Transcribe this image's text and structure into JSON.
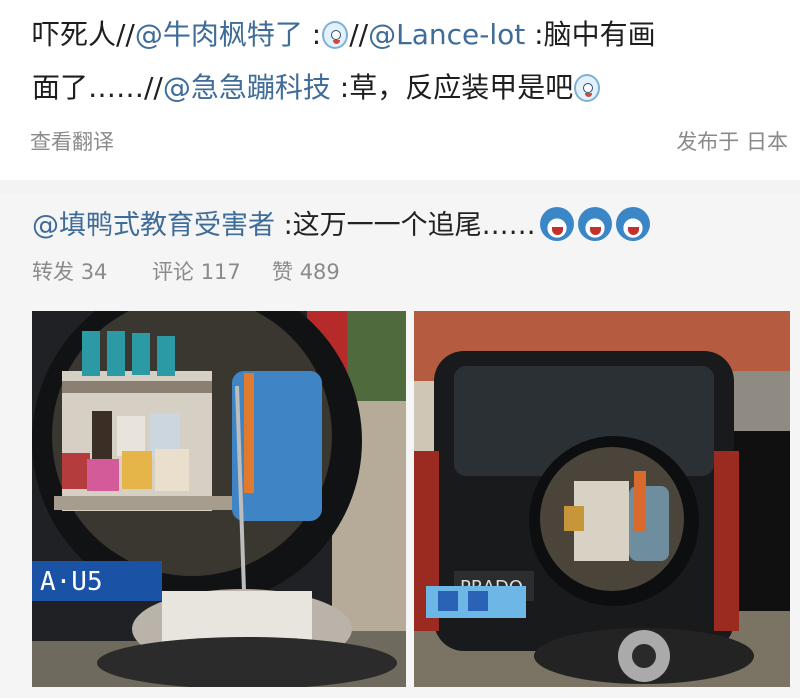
{
  "post": {
    "line1": {
      "prefix": "吓死人//",
      "mention1": "@牛肉枫特了",
      "after1": " :",
      "sep": "//",
      "mention2": "@Lance-lot",
      "after2": " :脑中有画"
    },
    "line2": {
      "prefix": "面了……//",
      "mention": "@急急蹦科技",
      "after": " :草，反应装甲是吧"
    },
    "translate_label": "查看翻译",
    "published": "发布于 日本"
  },
  "repost": {
    "author": "@填鸭式教育受害者",
    "text": " :这万一一个追尾……",
    "stats": {
      "repost_label": "转发",
      "repost_count": "34",
      "comment_label": "评论",
      "comment_count": "117",
      "like_label": "赞",
      "like_count": "489"
    },
    "photos": [
      {
        "plate_text": "A·U5"
      },
      {
        "badge_text": "PRADO"
      }
    ]
  },
  "colors": {
    "mention": "#3f6c98",
    "meta": "#8a8a8a",
    "repost_bg": "#f5f5f5"
  },
  "icons": [
    "doge-face-emoji",
    "dizzy-face-emoji"
  ]
}
